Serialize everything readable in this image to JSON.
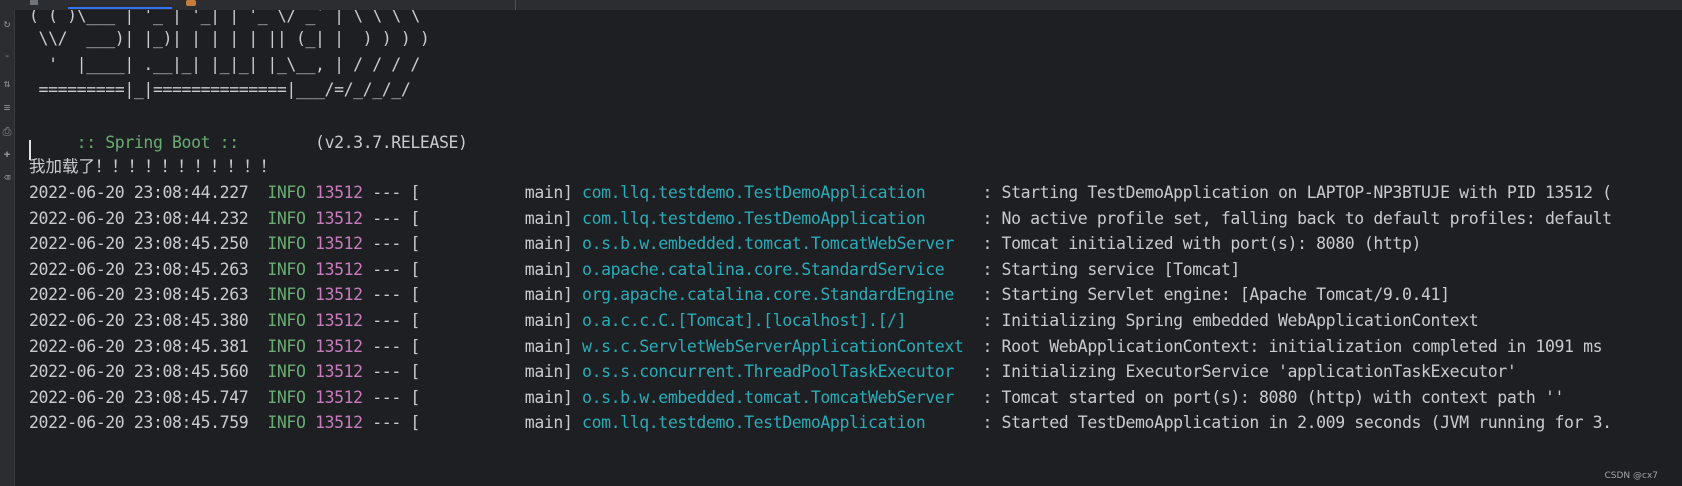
{
  "banner": {
    "lines": [
      "( ( )\\___ | '_ | '_| | '_ \\/ _` | \\ \\ \\ \\",
      " \\\\/  ___)| |_)| | | | | || (_| |  ) ) ) )",
      "  '  |____| .__|_| |_|_| |_\\__, | / / / /",
      " =========|_|==============|___/=/_/_/_/"
    ],
    "spring_label": " :: Spring Boot :: ",
    "spring_version": "       (v2.3.7.RELEASE)"
  },
  "custom_message": "我加载了！！！！！！！！！！！",
  "log_lines": [
    {
      "timestamp": "2022-06-20 23:08:44.227",
      "level": "INFO",
      "pid": "13512",
      "separator": "--- [",
      "thread": "           main]",
      "logger": "com.llq.testdemo.TestDemoApplication     ",
      "message": ": Starting TestDemoApplication on LAPTOP-NP3BTUJE with PID 13512 ("
    },
    {
      "timestamp": "2022-06-20 23:08:44.232",
      "level": "INFO",
      "pid": "13512",
      "separator": "--- [",
      "thread": "           main]",
      "logger": "com.llq.testdemo.TestDemoApplication     ",
      "message": ": No active profile set, falling back to default profiles: default"
    },
    {
      "timestamp": "2022-06-20 23:08:45.250",
      "level": "INFO",
      "pid": "13512",
      "separator": "--- [",
      "thread": "           main]",
      "logger": "o.s.b.w.embedded.tomcat.TomcatWebServer  ",
      "message": ": Tomcat initialized with port(s): 8080 (http)"
    },
    {
      "timestamp": "2022-06-20 23:08:45.263",
      "level": "INFO",
      "pid": "13512",
      "separator": "--- [",
      "thread": "           main]",
      "logger": "o.apache.catalina.core.StandardService   ",
      "message": ": Starting service [Tomcat]"
    },
    {
      "timestamp": "2022-06-20 23:08:45.263",
      "level": "INFO",
      "pid": "13512",
      "separator": "--- [",
      "thread": "           main]",
      "logger": "org.apache.catalina.core.StandardEngine  ",
      "message": ": Starting Servlet engine: [Apache Tomcat/9.0.41]"
    },
    {
      "timestamp": "2022-06-20 23:08:45.380",
      "level": "INFO",
      "pid": "13512",
      "separator": "--- [",
      "thread": "           main]",
      "logger": "o.a.c.c.C.[Tomcat].[localhost].[/]       ",
      "message": ": Initializing Spring embedded WebApplicationContext"
    },
    {
      "timestamp": "2022-06-20 23:08:45.381",
      "level": "INFO",
      "pid": "13512",
      "separator": "--- [",
      "thread": "           main]",
      "logger": "w.s.c.ServletWebServerApplicationContext ",
      "message": ": Root WebApplicationContext: initialization completed in 1091 ms"
    },
    {
      "timestamp": "2022-06-20 23:08:45.560",
      "level": "INFO",
      "pid": "13512",
      "separator": "--- [",
      "thread": "           main]",
      "logger": "o.s.s.concurrent.ThreadPoolTaskExecutor  ",
      "message": ": Initializing ExecutorService 'applicationTaskExecutor'"
    },
    {
      "timestamp": "2022-06-20 23:08:45.747",
      "level": "INFO",
      "pid": "13512",
      "separator": "--- [",
      "thread": "           main]",
      "logger": "o.s.b.w.embedded.tomcat.TomcatWebServer  ",
      "message": ": Tomcat started on port(s): 8080 (http) with context path ''"
    },
    {
      "timestamp": "2022-06-20 23:08:45.759",
      "level": "INFO",
      "pid": "13512",
      "separator": "--- [",
      "thread": "           main]",
      "logger": "com.llq.testdemo.TestDemoApplication     ",
      "message": ": Started TestDemoApplication in 2.009 seconds (JVM running for 3."
    }
  ],
  "gutter_icons": [
    "restart-icon",
    "stop-icon",
    "scroll-icon",
    "soft-wrap-icon",
    "print-icon",
    "pin-icon",
    "delete-icon"
  ],
  "watermark": "CSDN @cx7"
}
